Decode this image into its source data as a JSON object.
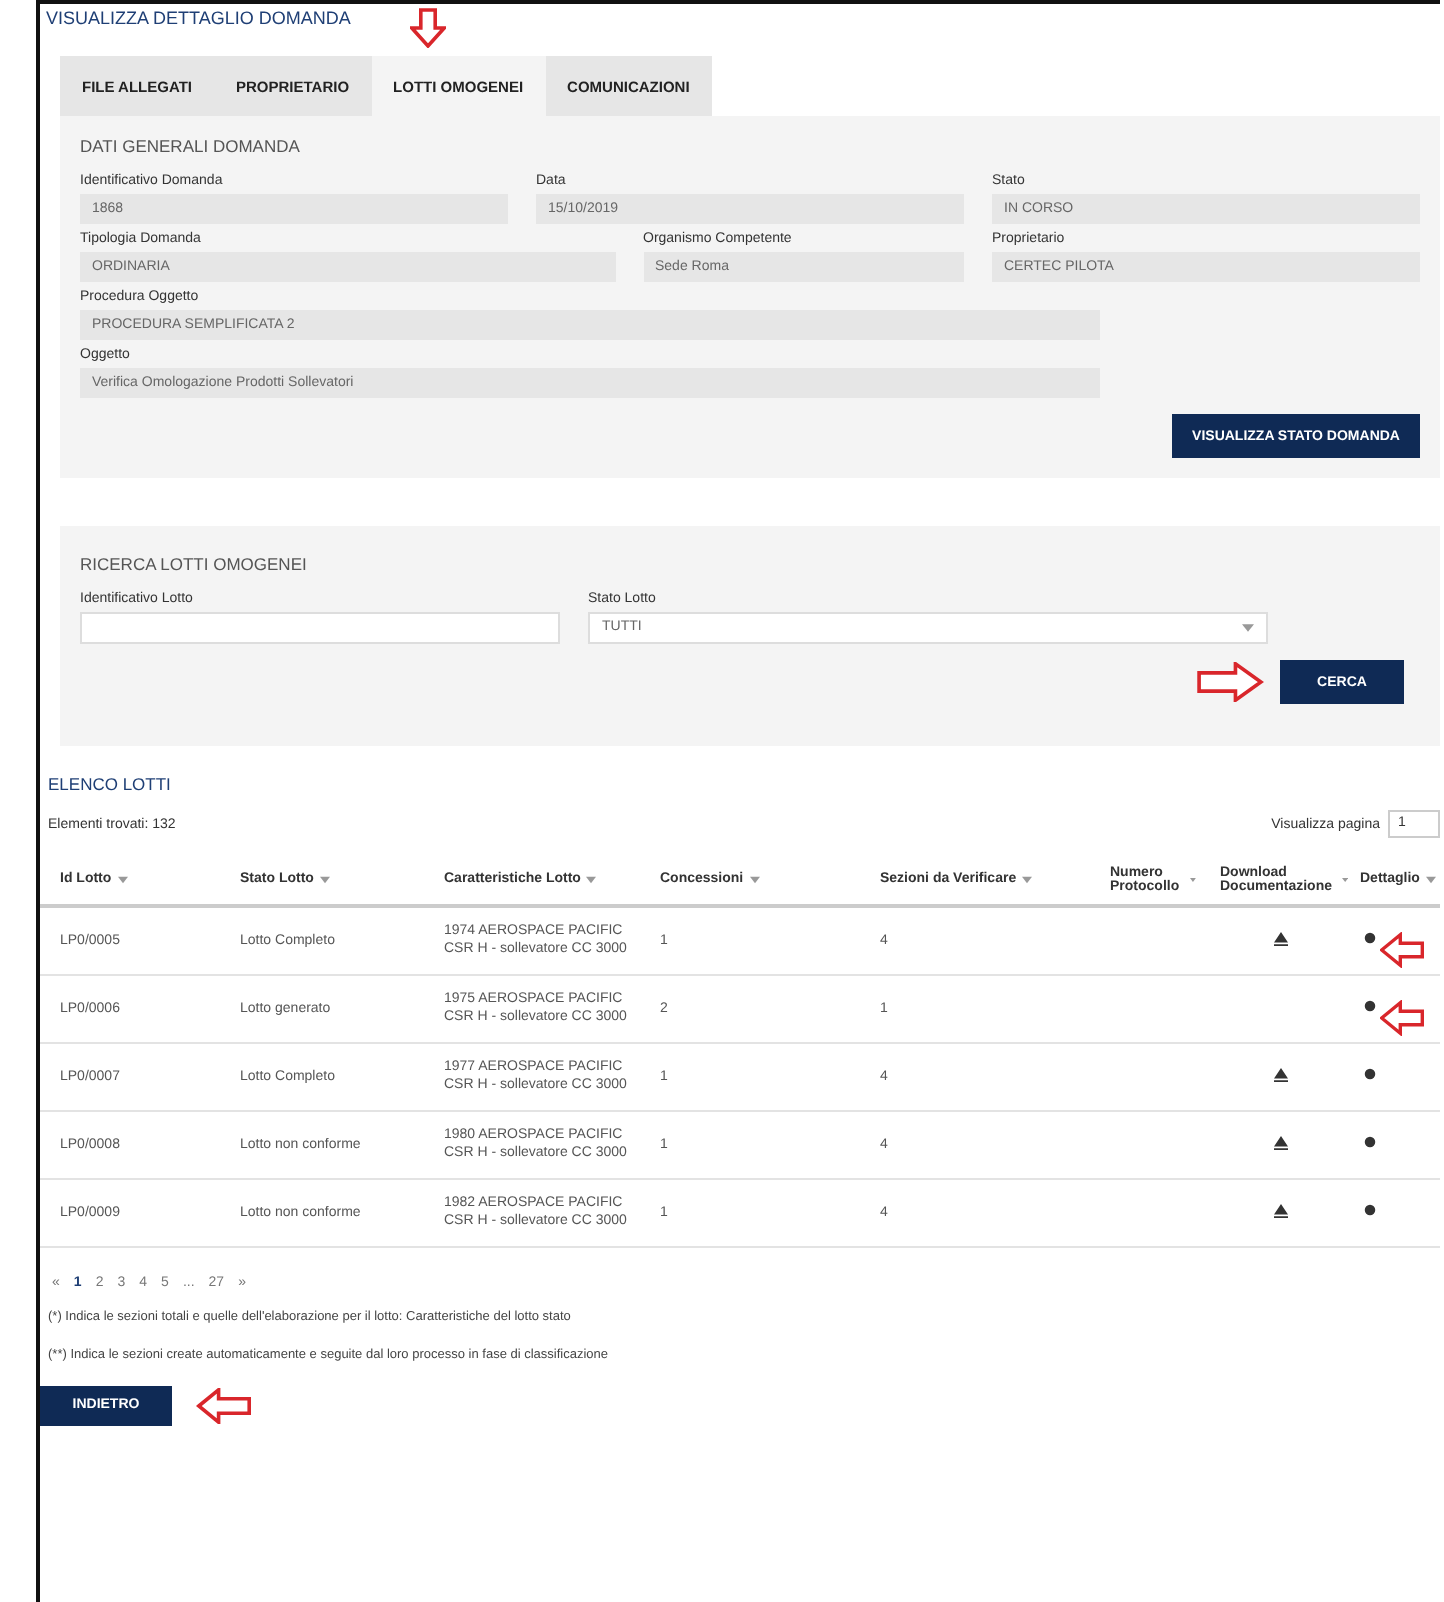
{
  "page_title": "VISUALIZZA DETTAGLIO DOMANDA",
  "tabs": [
    {
      "label": "FILE ALLEGATI",
      "selected": false
    },
    {
      "label": "PROPRIETARIO",
      "selected": false
    },
    {
      "label": "LOTTI OMOGENEI",
      "selected": true
    },
    {
      "label": "COMUNICAZIONI",
      "selected": false
    }
  ],
  "general": {
    "title": "DATI GENERALI DOMANDA",
    "rows": [
      [
        {
          "label": "Identificativo Domanda",
          "value": "1868"
        },
        {
          "label": "Data",
          "value": "15/10/2019"
        },
        {
          "label": "Stato",
          "value": "IN CORSO"
        }
      ],
      [
        {
          "label": "Tipologia Domanda",
          "value": "ORDINARIA"
        },
        {
          "label": "Organismo Competente",
          "value": "Sede Roma"
        },
        {
          "label": "Proprietario",
          "value": "CERTEC PILOTA"
        }
      ],
      [
        {
          "label": "Procedura Oggetto",
          "value": "PROCEDURA SEMPLIFICATA 2"
        }
      ],
      [
        {
          "label": "Oggetto",
          "value": "Verifica Omologazione Prodotti Sollevatori"
        }
      ]
    ],
    "button": "VISUALIZZA STATO DOMANDA"
  },
  "search": {
    "title": "RICERCA LOTTI OMOGENEI",
    "fields": [
      {
        "label": "Identificativo Lotto",
        "kind": "input"
      },
      {
        "label": "Stato Lotto",
        "kind": "select",
        "value": "TUTTI"
      }
    ],
    "button": "CERCA"
  },
  "list": {
    "title": "ELENCO LOTTI",
    "count": "Elementi trovati: 132",
    "page_label": "Visualizza pagina",
    "page_value": "1",
    "columns": [
      "Id Lotto",
      "Stato Lotto",
      "Caratteristiche Lotto",
      "Concessioni",
      "Sezioni da Verificare",
      "Numero Protocollo",
      "Download Documentazione",
      "Dettaglio"
    ],
    "rows": [
      {
        "id": "LP0/0005",
        "stato": "Lotto Completo",
        "caratteristiche": "1974 AEROSPACE PACIFIC CSR H - sollevatore CC 3000",
        "concessioni": "1",
        "sezioni": "4",
        "download": true,
        "annotated": true
      },
      {
        "id": "LP0/0006",
        "stato": "Lotto generato",
        "caratteristiche": "1975 AEROSPACE PACIFIC CSR H - sollevatore CC 3000",
        "concessioni": "2",
        "sezioni": "1",
        "download": false,
        "annotated": true
      },
      {
        "id": "LP0/0007",
        "stato": "Lotto Completo",
        "caratteristiche": "1977 AEROSPACE PACIFIC CSR H - sollevatore CC 3000",
        "concessioni": "1",
        "sezioni": "4",
        "download": true,
        "annotated": false
      },
      {
        "id": "LP0/0008",
        "stato": "Lotto non conforme",
        "caratteristiche": "1980 AEROSPACE PACIFIC CSR H - sollevatore CC 3000",
        "concessioni": "1",
        "sezioni": "4",
        "download": true,
        "annotated": false
      },
      {
        "id": "LP0/0009",
        "stato": "Lotto non conforme",
        "caratteristiche": "1982 AEROSPACE PACIFIC CSR H - sollevatore CC 3000",
        "concessioni": "1",
        "sezioni": "4",
        "download": true,
        "annotated": false
      }
    ],
    "pagination": [
      {
        "label": "«",
        "selected": false
      },
      {
        "label": "1",
        "selected": true
      },
      {
        "label": "2",
        "selected": false
      },
      {
        "label": "3",
        "selected": false
      },
      {
        "label": "4",
        "selected": false
      },
      {
        "label": "5",
        "selected": false
      },
      {
        "label": "...",
        "selected": false
      },
      {
        "label": "27",
        "selected": false
      },
      {
        "label": "»",
        "selected": false
      }
    ],
    "notes": [
      "(*) Indica le sezioni totali e quelle dell'elaborazione per il lotto: Caratteristiche del lotto stato",
      "(**) Indica le sezioni create automaticamente e seguite dal loro processo in fase di classificazione"
    ]
  },
  "back_button": "INDIETRO"
}
